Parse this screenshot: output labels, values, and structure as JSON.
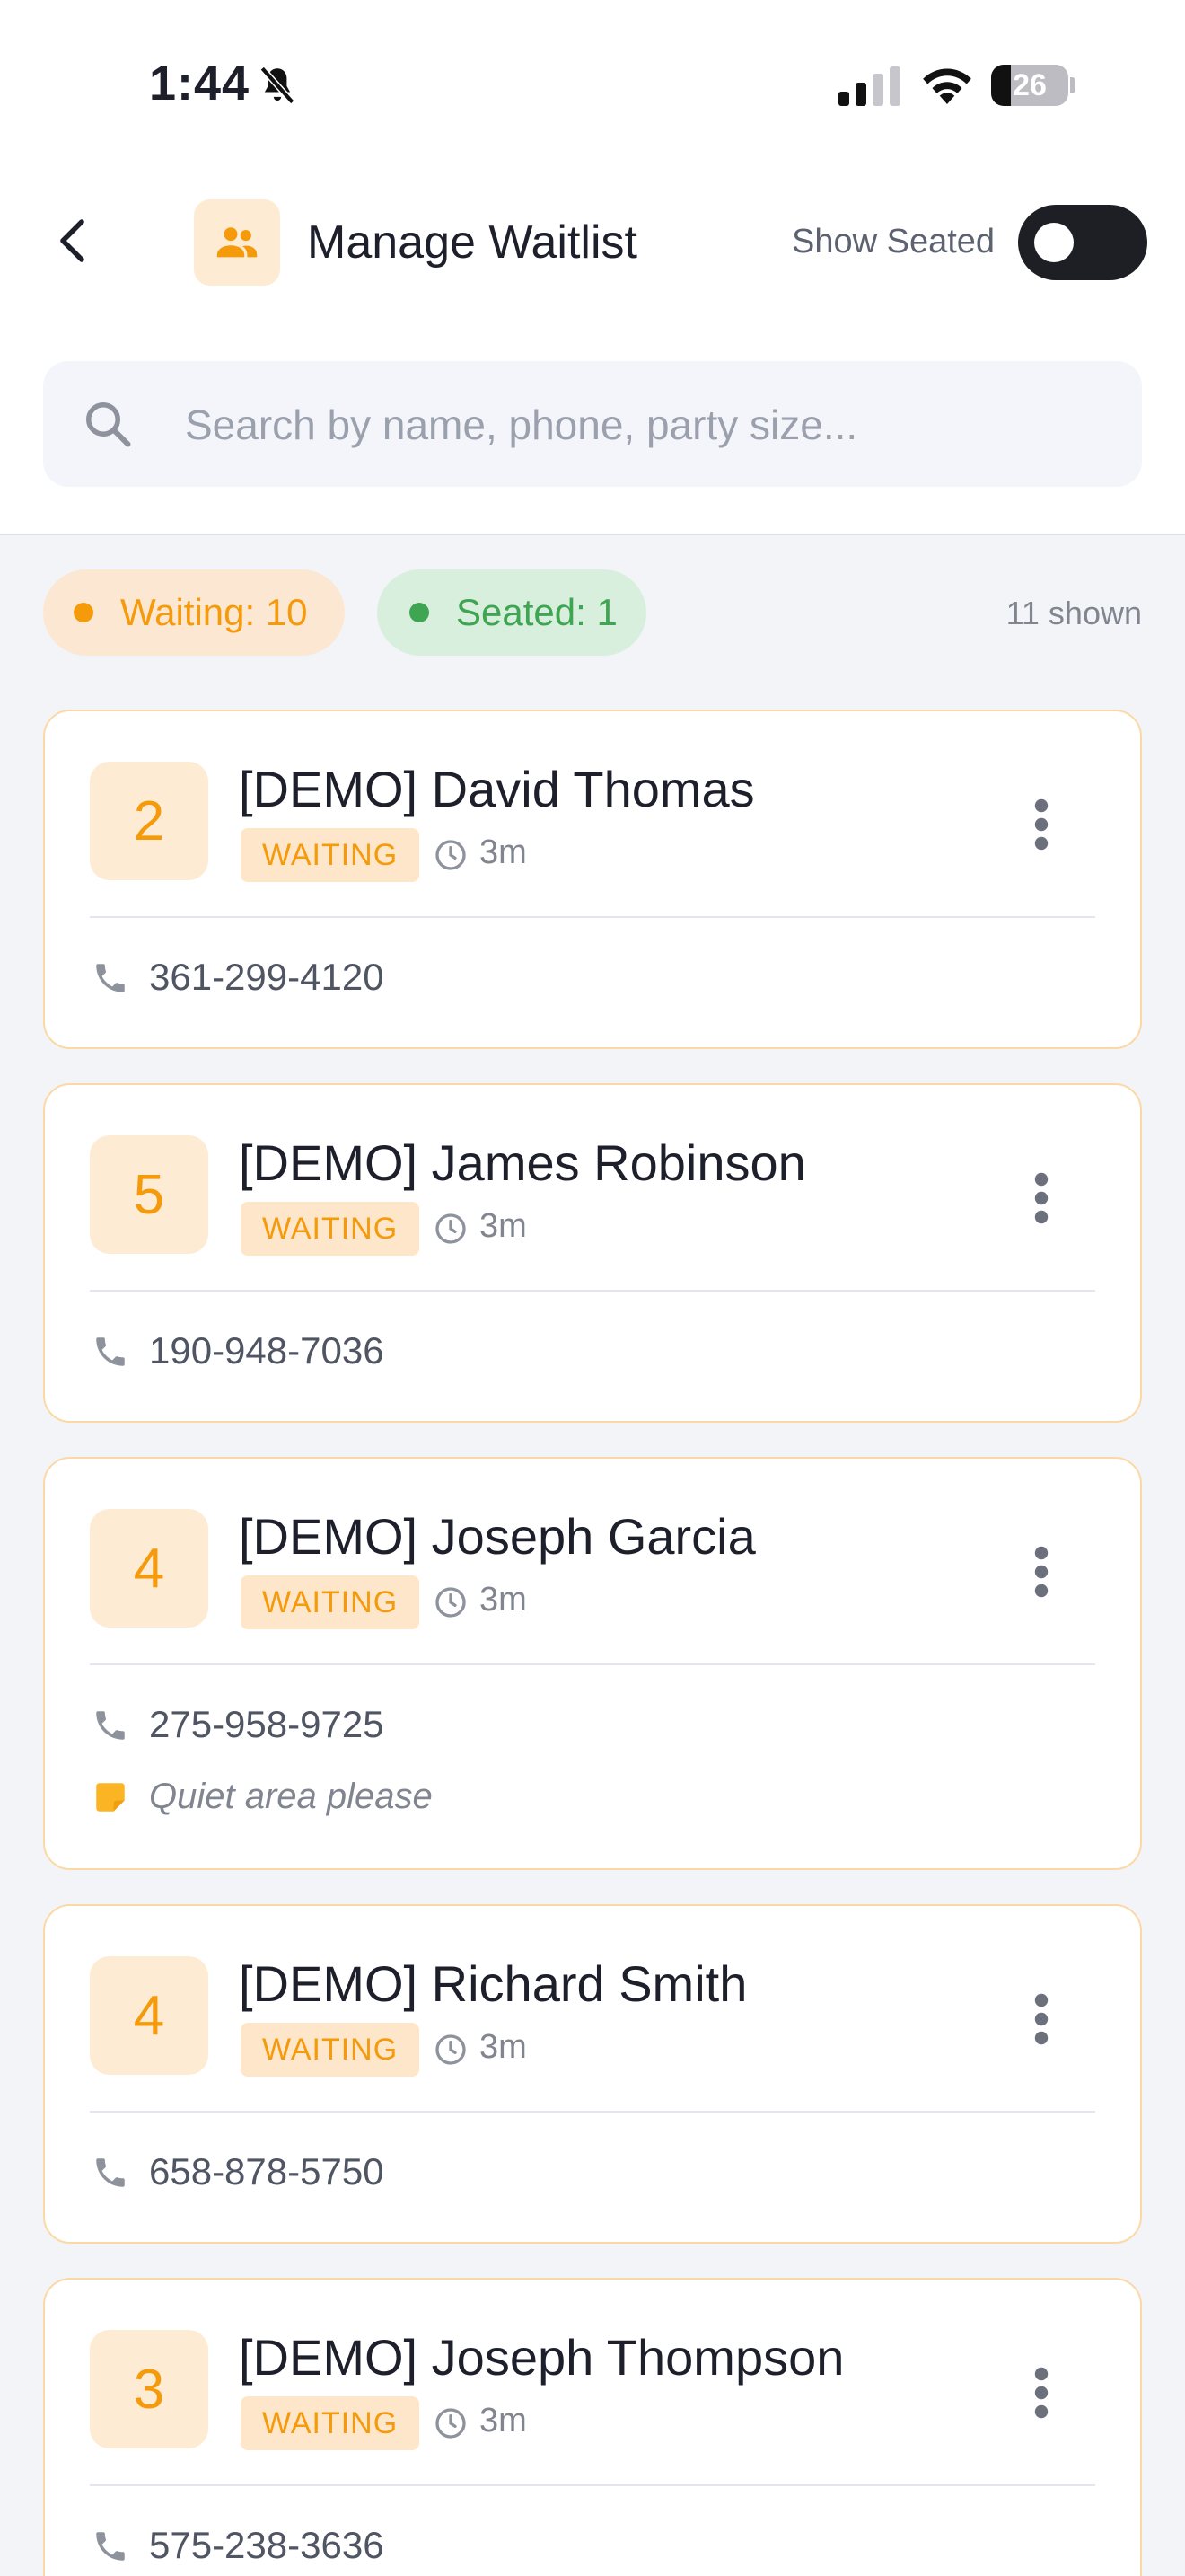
{
  "status_bar": {
    "time": "1:44",
    "battery": "26"
  },
  "header": {
    "title": "Manage Waitlist",
    "show_seated_label": "Show Seated",
    "show_seated_on": false
  },
  "search": {
    "placeholder": "Search by name, phone, party size...",
    "value": ""
  },
  "summary": {
    "waiting_label": "Waiting: 10",
    "seated_label": "Seated: 1",
    "shown_label": "11 shown"
  },
  "colors": {
    "accent_orange": "#f59a0b",
    "seated_green": "#3ea552",
    "card_border": "#fbd9a6"
  },
  "icons": {
    "back": "chevron-left-icon",
    "app": "people-icon",
    "search": "search-icon",
    "clock": "clock-icon",
    "phone": "phone-icon",
    "note": "note-icon",
    "menu": "more-vertical-icon"
  },
  "entries": [
    {
      "party_size": "2",
      "name": "[DEMO] David Thomas",
      "status": "WAITING",
      "wait_time": "3m",
      "phone": "361-299-4120",
      "note": ""
    },
    {
      "party_size": "5",
      "name": "[DEMO] James Robinson",
      "status": "WAITING",
      "wait_time": "3m",
      "phone": "190-948-7036",
      "note": ""
    },
    {
      "party_size": "4",
      "name": "[DEMO] Joseph Garcia",
      "status": "WAITING",
      "wait_time": "3m",
      "phone": "275-958-9725",
      "note": "Quiet area please"
    },
    {
      "party_size": "4",
      "name": "[DEMO] Richard Smith",
      "status": "WAITING",
      "wait_time": "3m",
      "phone": "658-878-5750",
      "note": ""
    },
    {
      "party_size": "3",
      "name": "[DEMO] Joseph Thompson",
      "status": "WAITING",
      "wait_time": "3m",
      "phone": "575-238-3636",
      "note": ""
    }
  ]
}
